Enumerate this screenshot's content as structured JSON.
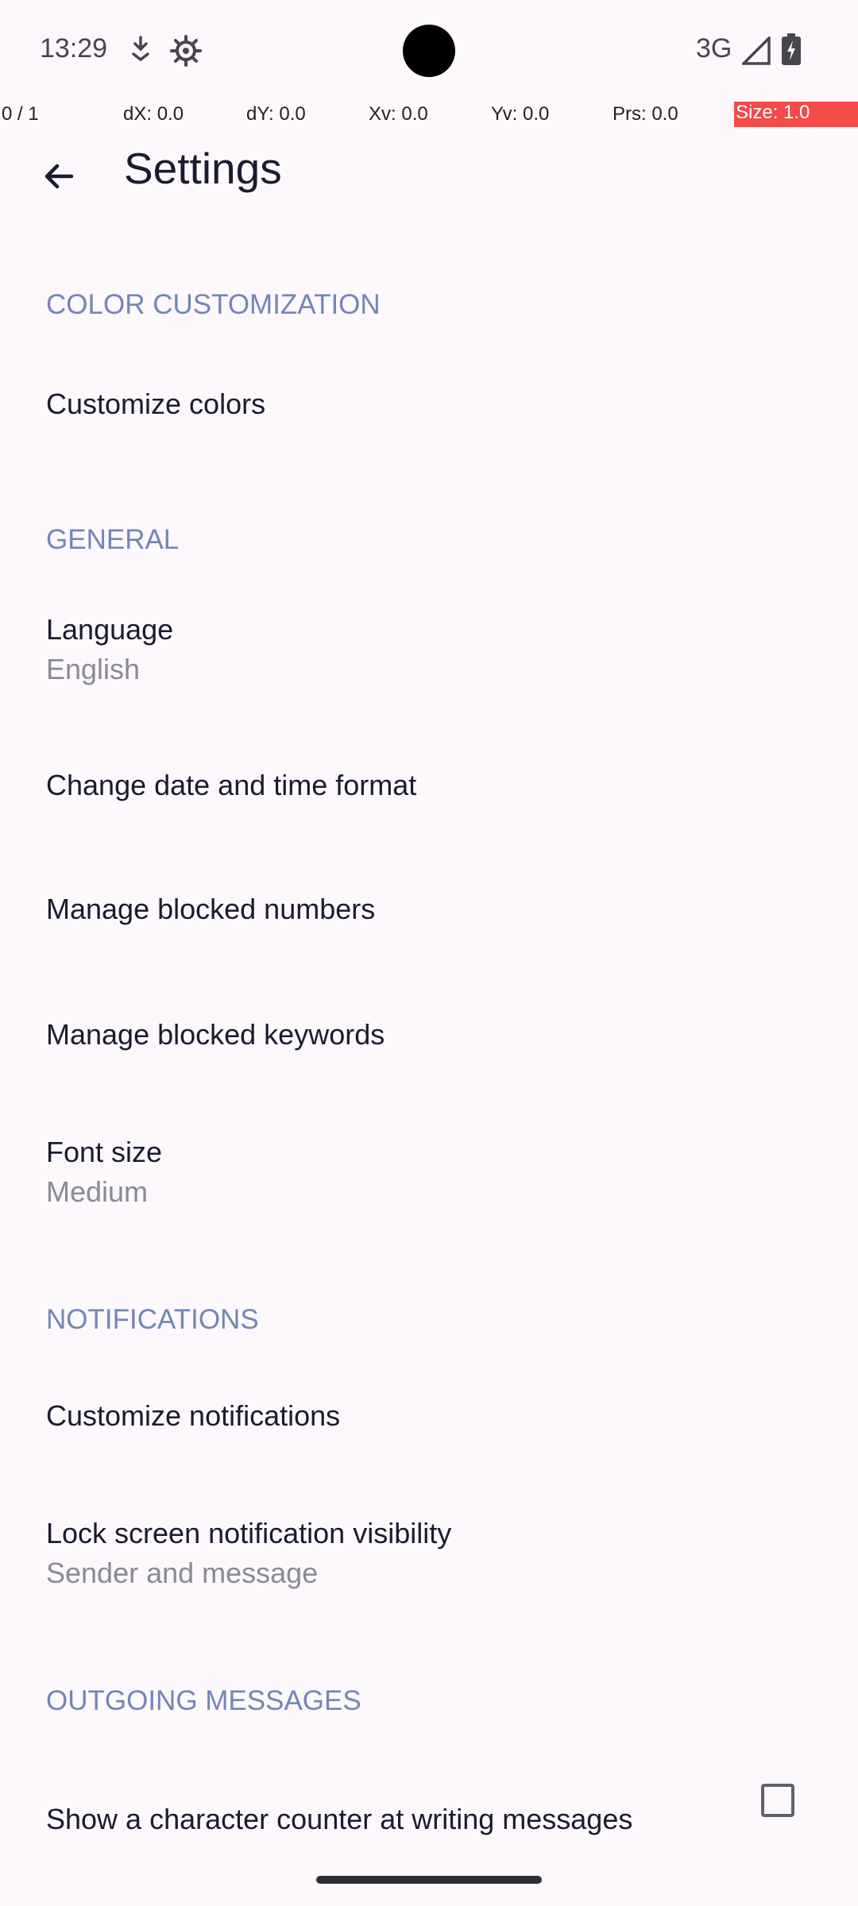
{
  "status_bar": {
    "time": "13:29",
    "network": "3G",
    "icons": [
      "download-arrow-icon",
      "settings-gear-icon",
      "signal-icon",
      "battery-charging-icon"
    ]
  },
  "pointer_overlay": {
    "pointers": "0 / 1",
    "dx": "dX: 0.0",
    "dy": "dY: 0.0",
    "xv": "Xv: 0.0",
    "yv": "Yv: 0.0",
    "prs": "Prs: 0.0",
    "size": "Size: 1.0"
  },
  "toolbar": {
    "title": "Settings",
    "back_icon": "arrow-back-icon"
  },
  "sections": {
    "color": {
      "header": "COLOR CUSTOMIZATION",
      "items": [
        {
          "title": "Customize colors"
        }
      ]
    },
    "general": {
      "header": "GENERAL",
      "items": [
        {
          "title": "Language",
          "subtitle": "English"
        },
        {
          "title": "Change date and time format"
        },
        {
          "title": "Manage blocked numbers"
        },
        {
          "title": "Manage blocked keywords"
        },
        {
          "title": "Font size",
          "subtitle": "Medium"
        }
      ]
    },
    "notifications": {
      "header": "NOTIFICATIONS",
      "items": [
        {
          "title": "Customize notifications"
        },
        {
          "title": "Lock screen notification visibility",
          "subtitle": "Sender and message"
        }
      ]
    },
    "outgoing": {
      "header": "OUTGOING MESSAGES",
      "items": [
        {
          "title": "Show a character counter at writing messages",
          "checked": false
        }
      ]
    }
  },
  "colors": {
    "background": "#fcf8fc",
    "header_text": "#7486b5",
    "primary_text": "#1b1b2f",
    "secondary_text": "#8a8a96",
    "size_badge": "#f44a4a"
  }
}
